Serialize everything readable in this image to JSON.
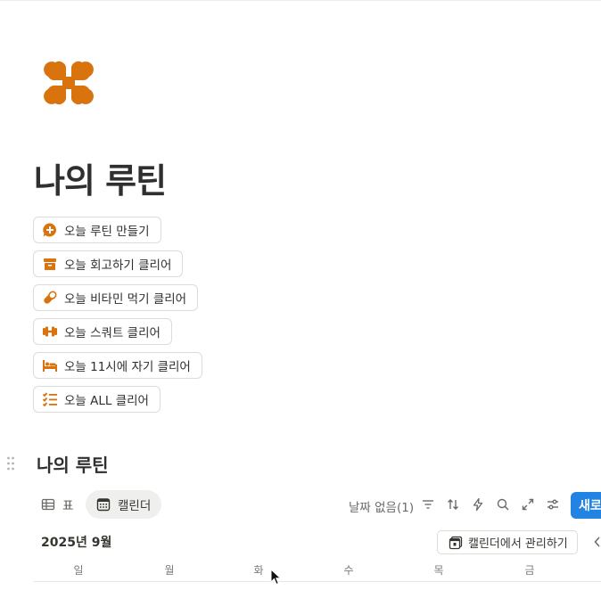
{
  "page": {
    "icon": "clover-icon",
    "title": "나의 루틴"
  },
  "buttons": [
    {
      "label": "오늘 루틴 만들기",
      "icon": "chat-plus-icon"
    },
    {
      "label": "오늘 회고하기 클리어",
      "icon": "archive-box-icon"
    },
    {
      "label": "오늘 비타민 먹기 클리어",
      "icon": "pill-icon"
    },
    {
      "label": "오늘 스쿼트 클리어",
      "icon": "dumbbell-icon"
    },
    {
      "label": "오늘 11시에 자기 클리어",
      "icon": "bed-icon"
    },
    {
      "label": "오늘 ALL 클리어",
      "icon": "checklist-icon"
    }
  ],
  "database": {
    "title": "나의 루틴",
    "views": [
      {
        "label": "표",
        "icon": "table-icon",
        "active": false
      },
      {
        "label": "캘린더",
        "icon": "calendar-icon",
        "active": true
      }
    ],
    "no_date_label": "날짜 없음(1)",
    "toolbar_icons": [
      "filter-icon",
      "sort-icon",
      "lightning-icon",
      "search-icon",
      "expand-icon",
      "settings-sliders-icon"
    ],
    "new_button": "새로"
  },
  "calendar": {
    "month": "2025년 9월",
    "manage_label": "캘린더에서 관리하기",
    "weekdays": [
      "일",
      "월",
      "화",
      "수",
      "목",
      "금"
    ]
  },
  "colors": {
    "accent": "#d9730d",
    "primary_button": "#2383e2",
    "text": "#37352f"
  }
}
